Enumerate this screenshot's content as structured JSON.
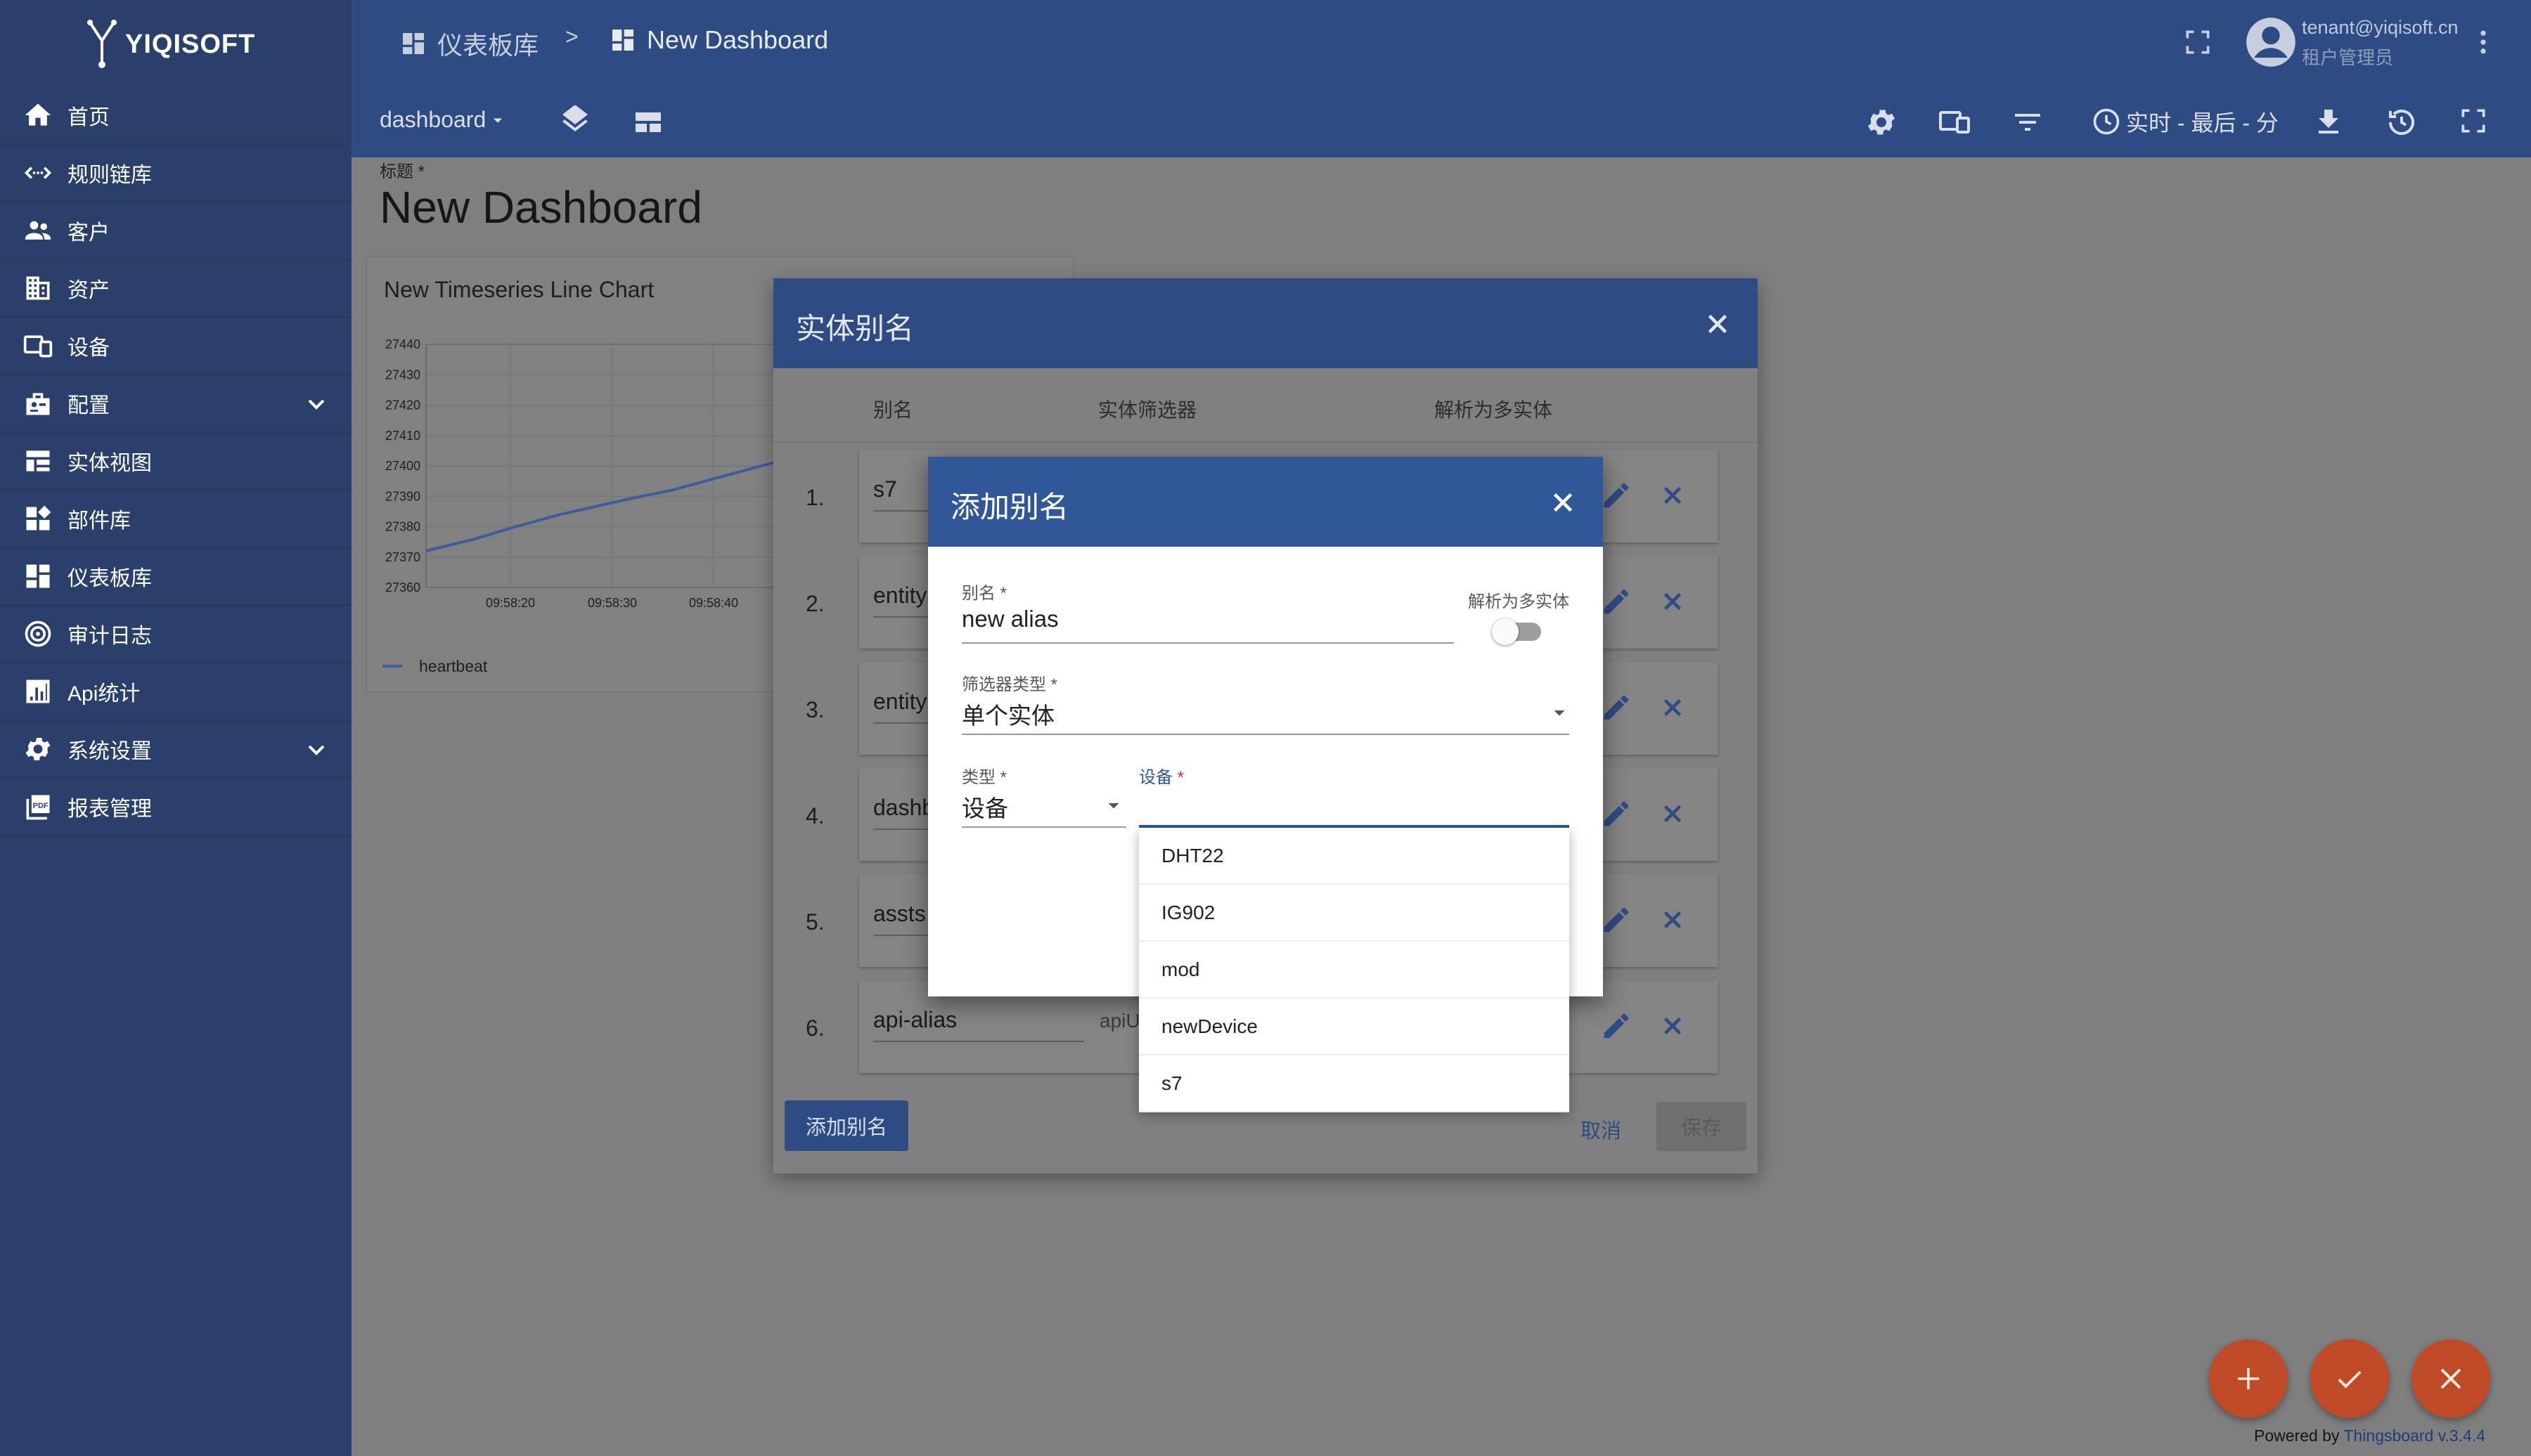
{
  "brand": {
    "name": "YIQISOFT"
  },
  "sidebar": {
    "items": [
      {
        "label": "首页",
        "icon": "home-icon"
      },
      {
        "label": "规则链库",
        "icon": "rule-chain-icon"
      },
      {
        "label": "客户",
        "icon": "customers-icon"
      },
      {
        "label": "资产",
        "icon": "assets-icon"
      },
      {
        "label": "设备",
        "icon": "devices-icon"
      },
      {
        "label": "配置",
        "icon": "profiles-icon",
        "expandable": true
      },
      {
        "label": "实体视图",
        "icon": "entity-view-icon"
      },
      {
        "label": "部件库",
        "icon": "widgets-icon"
      },
      {
        "label": "仪表板库",
        "icon": "dashboards-icon"
      },
      {
        "label": "审计日志",
        "icon": "audit-log-icon"
      },
      {
        "label": "Api统计",
        "icon": "api-stats-icon"
      },
      {
        "label": "系统设置",
        "icon": "settings-icon",
        "expandable": true
      },
      {
        "label": "报表管理",
        "icon": "pdf-report-icon"
      }
    ]
  },
  "header": {
    "breadcrumb_root": "仪表板库",
    "breadcrumb_separator": ">",
    "breadcrumb_current": "New Dashboard",
    "user_email": "tenant@yiqisoft.cn",
    "user_role": "租户管理员"
  },
  "toolbar": {
    "dashboard_state": "dashboard",
    "timewindow": "实时 - 最后 - 分"
  },
  "dashboard": {
    "title_label": "标题 *",
    "title": "New Dashboard"
  },
  "chart_data": {
    "type": "line",
    "title": "New Timeseries Line Chart",
    "y_ticks": [
      27440,
      27430,
      27420,
      27410,
      27400,
      27390,
      27380,
      27370,
      27360
    ],
    "x_ticks": [
      "09:58:20",
      "09:58:30",
      "09:58:40"
    ],
    "ylim": [
      27360,
      27440
    ],
    "series": [
      {
        "name": "heartbeat",
        "color": "#3c5c9c",
        "points": [
          [
            0,
            27372
          ],
          [
            0.11,
            27376
          ],
          [
            0.2,
            27380
          ],
          [
            0.3,
            27384
          ],
          [
            0.45,
            27389
          ],
          [
            0.55,
            27392
          ],
          [
            0.7,
            27398
          ],
          [
            0.85,
            27404
          ],
          [
            1.0,
            27410
          ]
        ]
      }
    ],
    "legend": "bottom-left",
    "grid": true
  },
  "alias_dialog": {
    "title": "实体别名",
    "col_alias": "别名",
    "col_filter": "实体筛选器",
    "col_multi": "解析为多实体",
    "rows": [
      {
        "num": "1.",
        "alias": "s7",
        "filter": ""
      },
      {
        "num": "2.",
        "alias": "entity",
        "filter": ""
      },
      {
        "num": "3.",
        "alias": "entity",
        "filter": ""
      },
      {
        "num": "4.",
        "alias": "dashb",
        "filter": ""
      },
      {
        "num": "5.",
        "alias": "assts",
        "filter": ""
      },
      {
        "num": "6.",
        "alias": "api-alias",
        "filter": "apiU"
      }
    ],
    "add_button": "添加别名",
    "cancel_button": "取消",
    "save_button": "保存"
  },
  "add_alias_dialog": {
    "title": "添加别名",
    "alias_label": "别名 *",
    "alias_value": "new alias",
    "multi_label": "解析为多实体",
    "filter_type_label": "筛选器类型 *",
    "filter_type_value": "单个实体",
    "type_label": "类型 *",
    "type_value": "设备",
    "device_label": "设备",
    "device_required": "*"
  },
  "device_dropdown": {
    "options": [
      "DHT22",
      "IG902",
      "mod",
      "newDevice",
      "s7"
    ]
  },
  "footer": {
    "powered_by": "Powered by",
    "product": "Thingsboard v.3.4.4"
  },
  "colors": {
    "sidebar_bg": "#2a3f69",
    "header_bg": "#2f4b84",
    "dialog_header": "#305798",
    "fab": "#bf4a25",
    "accent_blue": "#305798"
  }
}
